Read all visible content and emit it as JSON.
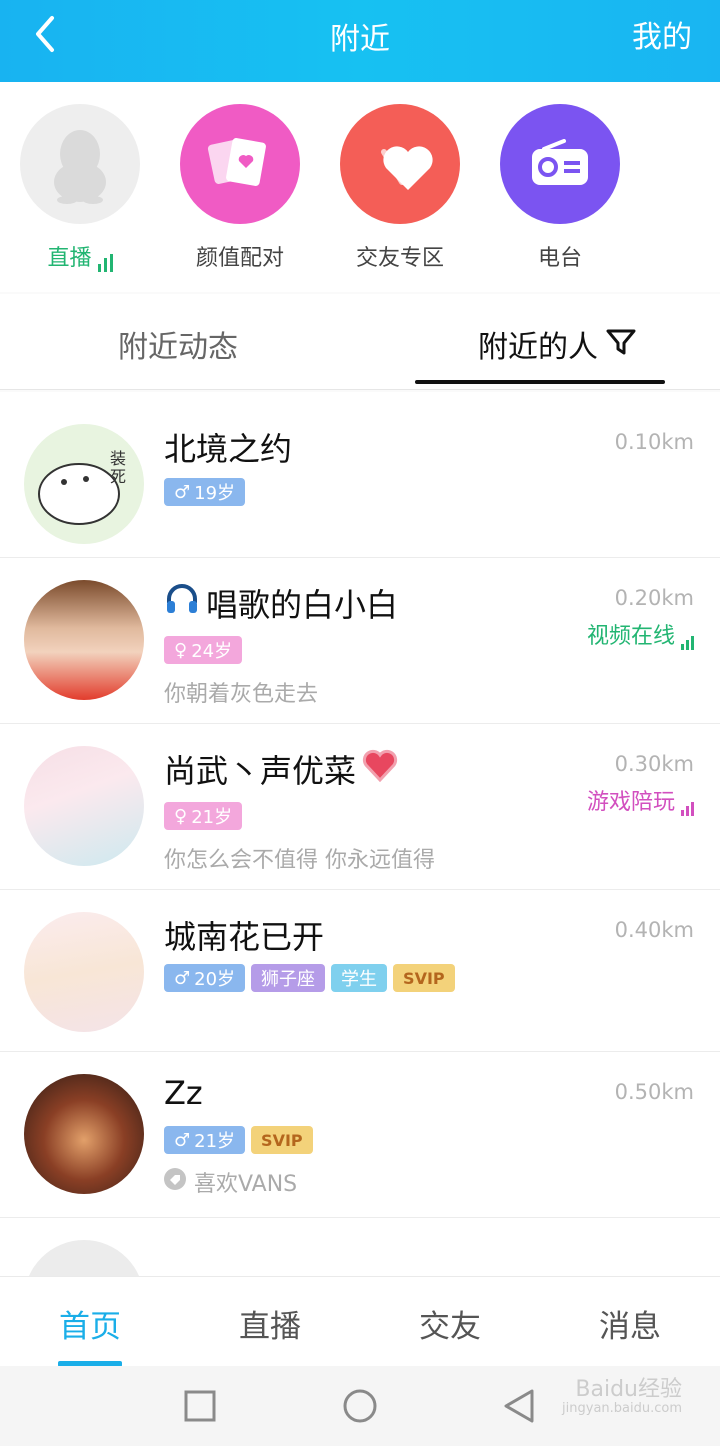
{
  "header": {
    "title": "附近",
    "right_label": "我的"
  },
  "entries": [
    {
      "label": "直播",
      "icon": "qq-penguin-icon",
      "color": "#eeeeee"
    },
    {
      "label": "颜值配对",
      "icon": "cards-heart-icon",
      "color": "#f05bc4"
    },
    {
      "label": "交友专区",
      "icon": "heart-icon",
      "color": "#f45e57"
    },
    {
      "label": "电台",
      "icon": "radio-icon",
      "color": "#7b54f1"
    }
  ],
  "tabs": {
    "left": "附近动态",
    "right": "附近的人"
  },
  "people": [
    {
      "name": "北境之约",
      "distance": "0.10km",
      "gender_age": "19岁",
      "gender": "male",
      "signature": "",
      "status": ""
    },
    {
      "name": "唱歌的白小白",
      "name_icon": "headphones-icon",
      "distance": "0.20km",
      "gender_age": "24岁",
      "gender": "female",
      "signature": "你朝着灰色走去",
      "status": "视频在线",
      "status_color": "#22b572"
    },
    {
      "name": "尚武丶声优菜",
      "name_icon": "heart-emoji-icon",
      "distance": "0.30km",
      "gender_age": "21岁",
      "gender": "female",
      "signature": "你怎么会不值得 你永远值得",
      "status": "游戏陪玩",
      "status_color": "#d24fbf"
    },
    {
      "name": "城南花已开",
      "distance": "0.40km",
      "gender_age": "20岁",
      "gender": "male",
      "tags": [
        "狮子座",
        "学生",
        "SVIP"
      ],
      "signature": "",
      "status": ""
    },
    {
      "name": "Zz",
      "distance": "0.50km",
      "gender_age": "21岁",
      "gender": "male",
      "tags": [
        "SVIP"
      ],
      "signature": "喜欢VANS",
      "status": ""
    }
  ],
  "bottom_nav": [
    "首页",
    "直播",
    "交友",
    "消息"
  ],
  "watermark": {
    "text": "Baidu经验",
    "sub": "jingyan.baidu.com"
  }
}
